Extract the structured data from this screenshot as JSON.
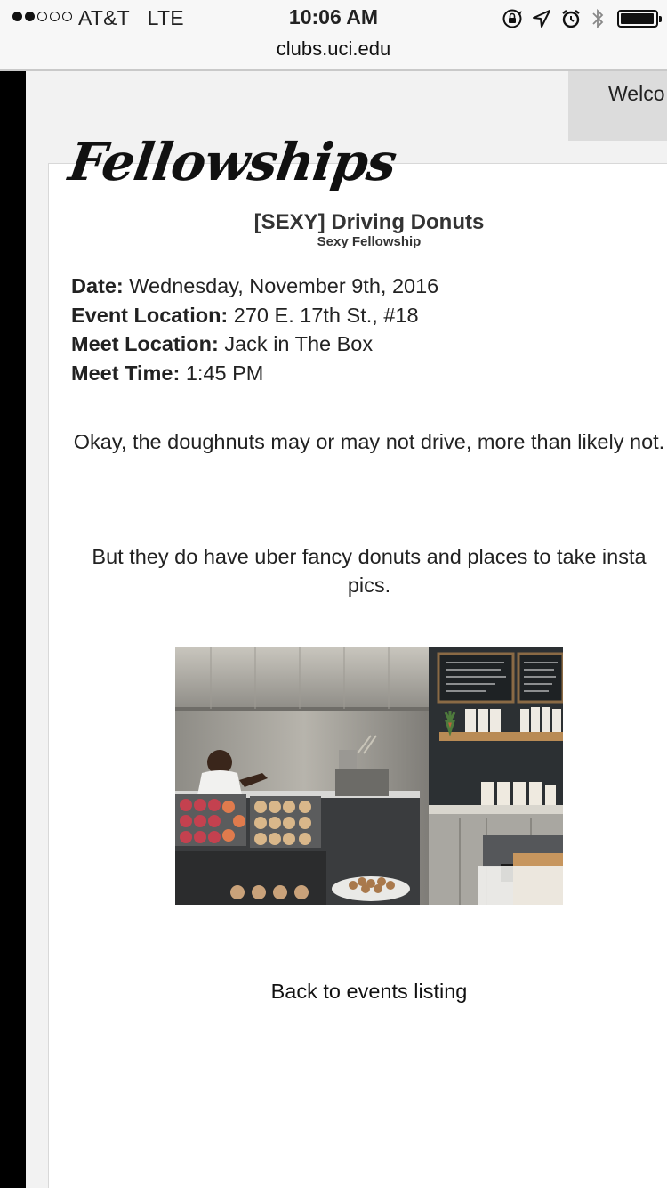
{
  "status_bar": {
    "signal_filled": 2,
    "signal_total": 5,
    "carrier": "AT&T",
    "network": "LTE",
    "time": "10:06 AM",
    "url": "clubs.uci.edu",
    "icons": [
      "orientation-lock-icon",
      "location-arrow-icon",
      "alarm-icon",
      "bluetooth-icon",
      "battery-icon"
    ]
  },
  "header": {
    "welcome_text": "Welco",
    "logo_text": "Fellowships"
  },
  "event": {
    "title": "[SEXY] Driving Donuts",
    "subtitle": "Sexy Fellowship",
    "date_label": "Date:",
    "date_value": "Wednesday, November 9th, 2016",
    "event_location_label": "Event Location:",
    "event_location_value": "270 E. 17th St., #18",
    "meet_location_label": "Meet Location:",
    "meet_location_value": "Jack in The Box",
    "meet_time_label": "Meet Time:",
    "meet_time_value": "1:45 PM",
    "paragraph_1": "Okay, the doughnuts may or may not drive, more than likely not.",
    "paragraph_2": "But they do have uber fancy donuts and places to take insta pics."
  },
  "footer": {
    "back_link": "Back to events listing"
  },
  "colors": {
    "page_bg": "#f2f2f2",
    "left_bar": "#000000",
    "welcome_tab": "#dcdcdc",
    "panel": "#ffffff"
  }
}
